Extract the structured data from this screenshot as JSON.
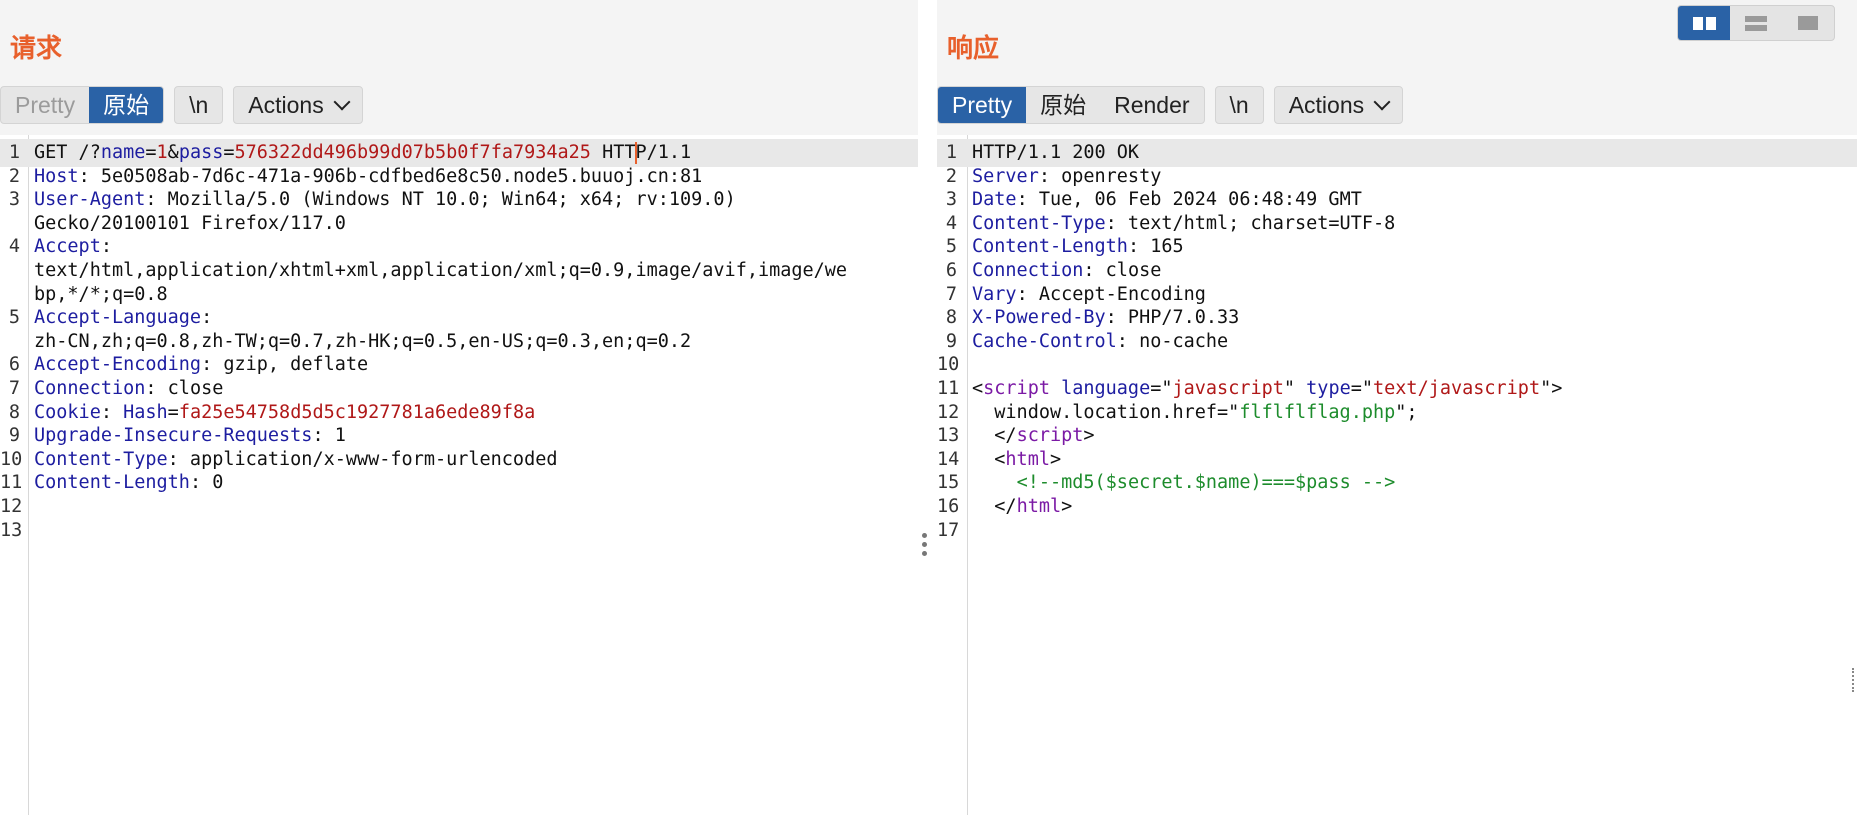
{
  "request": {
    "title": "请求",
    "view_tabs": [
      "Pretty",
      "原始"
    ],
    "newline_label": "\\n",
    "actions_label": "Actions",
    "lines": [
      {
        "n": "1",
        "parts": [
          [
            "GET /?",
            ""
          ],
          [
            "name",
            "k"
          ],
          [
            "=",
            ""
          ],
          [
            "1",
            "v"
          ],
          [
            "&",
            ""
          ],
          [
            "pass",
            "k"
          ],
          [
            "=",
            ""
          ],
          [
            "576322dd496b99d07b5b0f7fa7934a25",
            "v"
          ],
          [
            " HTT",
            ""
          ],
          [
            "|caret",
            ""
          ],
          [
            "P/1.1",
            ""
          ]
        ]
      },
      {
        "n": "2",
        "parts": [
          [
            "Host",
            "k"
          ],
          [
            ": 5e0508ab-7d6c-471a-906b-cdfbed6e8c50.node5.buuoj.cn:81",
            ""
          ]
        ]
      },
      {
        "n": "3",
        "parts": [
          [
            "User-Agent",
            "k"
          ],
          [
            ": Mozilla/5.0 (Windows NT 10.0; Win64; x64; rv:109.0)",
            ""
          ]
        ]
      },
      {
        "n": "",
        "parts": [
          [
            "Gecko/20100101 Firefox/117.0",
            ""
          ]
        ]
      },
      {
        "n": "4",
        "parts": [
          [
            "Accept",
            "k"
          ],
          [
            ":",
            ""
          ]
        ]
      },
      {
        "n": "",
        "parts": [
          [
            "text/html,application/xhtml+xml,application/xml;q=0.9,image/avif,image/we",
            ""
          ]
        ]
      },
      {
        "n": "",
        "parts": [
          [
            "bp,*/*;q=0.8",
            ""
          ]
        ]
      },
      {
        "n": "5",
        "parts": [
          [
            "Accept-Language",
            "k"
          ],
          [
            ":",
            ""
          ]
        ]
      },
      {
        "n": "",
        "parts": [
          [
            "zh-CN,zh;q=0.8,zh-TW;q=0.7,zh-HK;q=0.5,en-US;q=0.3,en;q=0.2",
            ""
          ]
        ]
      },
      {
        "n": "6",
        "parts": [
          [
            "Accept-Encoding",
            "k"
          ],
          [
            ": gzip, deflate",
            ""
          ]
        ]
      },
      {
        "n": "7",
        "parts": [
          [
            "Connection",
            "k"
          ],
          [
            ": close",
            ""
          ]
        ]
      },
      {
        "n": "8",
        "parts": [
          [
            "Cookie",
            "k"
          ],
          [
            ": ",
            ""
          ],
          [
            "Hash",
            "k"
          ],
          [
            "=",
            ""
          ],
          [
            "fa25e54758d5d5c1927781a6ede89f8a",
            "v"
          ]
        ]
      },
      {
        "n": "9",
        "parts": [
          [
            "Upgrade-Insecure-Requests",
            "k"
          ],
          [
            ": 1",
            ""
          ]
        ]
      },
      {
        "n": "10",
        "parts": [
          [
            "Content-Type",
            "k"
          ],
          [
            ": application/x-www-form-urlencoded",
            ""
          ]
        ]
      },
      {
        "n": "11",
        "parts": [
          [
            "Content-Length",
            "k"
          ],
          [
            ": 0",
            ""
          ]
        ]
      },
      {
        "n": "12",
        "parts": []
      },
      {
        "n": "13",
        "parts": []
      }
    ]
  },
  "response": {
    "title": "响应",
    "view_tabs": [
      "Pretty",
      "原始",
      "Render"
    ],
    "newline_label": "\\n",
    "actions_label": "Actions",
    "lines": [
      {
        "n": "1",
        "parts": [
          [
            "HTTP/1.1 200 OK",
            ""
          ]
        ]
      },
      {
        "n": "2",
        "parts": [
          [
            "Server",
            "k"
          ],
          [
            ": openresty",
            ""
          ]
        ]
      },
      {
        "n": "3",
        "parts": [
          [
            "Date",
            "k"
          ],
          [
            ": Tue, 06 Feb 2024 06:48:49 GMT",
            ""
          ]
        ]
      },
      {
        "n": "4",
        "parts": [
          [
            "Content-Type",
            "k"
          ],
          [
            ": text/html; charset=UTF-8",
            ""
          ]
        ]
      },
      {
        "n": "5",
        "parts": [
          [
            "Content-Length",
            "k"
          ],
          [
            ": 165",
            ""
          ]
        ]
      },
      {
        "n": "6",
        "parts": [
          [
            "Connection",
            "k"
          ],
          [
            ": close",
            ""
          ]
        ]
      },
      {
        "n": "7",
        "parts": [
          [
            "Vary",
            "k"
          ],
          [
            ": Accept-Encoding",
            ""
          ]
        ]
      },
      {
        "n": "8",
        "parts": [
          [
            "X-Powered-By",
            "k"
          ],
          [
            ": PHP/7.0.33",
            ""
          ]
        ]
      },
      {
        "n": "9",
        "parts": [
          [
            "Cache-Control",
            "k"
          ],
          [
            ": no-cache",
            ""
          ]
        ]
      },
      {
        "n": "10",
        "parts": []
      },
      {
        "n": "11",
        "parts": [
          [
            "<",
            ""
          ],
          [
            "script",
            "tag"
          ],
          [
            " ",
            ""
          ],
          [
            "language",
            "attr"
          ],
          [
            "=\"",
            ""
          ],
          [
            "javascript",
            "str"
          ],
          [
            "\" ",
            ""
          ],
          [
            "type",
            "attr"
          ],
          [
            "=\"",
            ""
          ],
          [
            "text/javascript",
            "str"
          ],
          [
            "\">",
            ""
          ]
        ]
      },
      {
        "n": "12",
        "parts": [
          [
            "  window.location.href=\"",
            ""
          ],
          [
            "flflflflag.php",
            "green"
          ],
          [
            "\";",
            ""
          ]
        ]
      },
      {
        "n": "13",
        "parts": [
          [
            "  </",
            ""
          ],
          [
            "script",
            "tag"
          ],
          [
            ">",
            ""
          ]
        ]
      },
      {
        "n": "14",
        "parts": [
          [
            "  <",
            ""
          ],
          [
            "html",
            "tag"
          ],
          [
            ">",
            ""
          ]
        ]
      },
      {
        "n": "15",
        "parts": [
          [
            "    ",
            ""
          ],
          [
            "<!--md5($secret.$name)===$pass -->",
            "green"
          ]
        ]
      },
      {
        "n": "16",
        "parts": [
          [
            "  </",
            ""
          ],
          [
            "html",
            "tag"
          ],
          [
            ">",
            ""
          ]
        ]
      },
      {
        "n": "17",
        "parts": []
      }
    ]
  },
  "layout_buttons": [
    "split-view-icon",
    "rows-view-icon",
    "single-view-icon"
  ],
  "colors": {
    "accent": "#2a62a6",
    "title": "#e8602c",
    "key": "#1d1da0",
    "value": "#b01818",
    "tag": "#7b1aa5",
    "comment": "#1d8c2c"
  }
}
